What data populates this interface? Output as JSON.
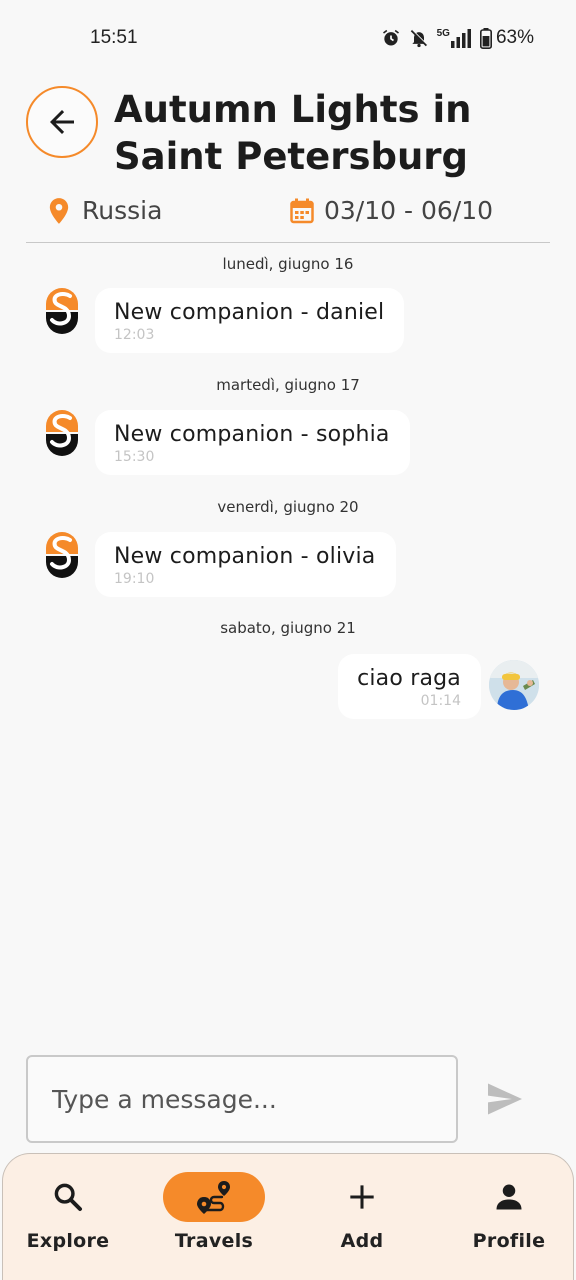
{
  "status_bar": {
    "time": "15:51",
    "battery": "63%",
    "network": "5G"
  },
  "header": {
    "back_icon": "arrow-left-icon",
    "title": "Autumn Lights in Saint Petersburg",
    "location": "Russia",
    "dates": "03/10 - 06/10"
  },
  "messages": [
    {
      "date": "lunedì, giugno 16",
      "text": "New companion - daniel",
      "time": "12:03",
      "sender": "system"
    },
    {
      "date": "martedì, giugno 17",
      "text": "New companion - sophia",
      "time": "15:30",
      "sender": "system"
    },
    {
      "date": "venerdì, giugno 20",
      "text": "New companion - olivia",
      "time": "19:10",
      "sender": "system"
    },
    {
      "date": "sabato, giugno 21",
      "text": "ciao raga",
      "time": "01:14",
      "sender": "me"
    }
  ],
  "composer": {
    "placeholder": "Type a message...",
    "send_icon": "send-icon"
  },
  "nav": {
    "items": [
      {
        "label": "Explore",
        "icon": "search-icon"
      },
      {
        "label": "Travels",
        "icon": "route-icon",
        "active": true
      },
      {
        "label": "Add",
        "icon": "plus-icon"
      },
      {
        "label": "Profile",
        "icon": "person-icon"
      }
    ]
  },
  "colors": {
    "accent": "#f58a2a",
    "nav_background": "#fcefe4",
    "page_background": "#f8f8f8"
  }
}
